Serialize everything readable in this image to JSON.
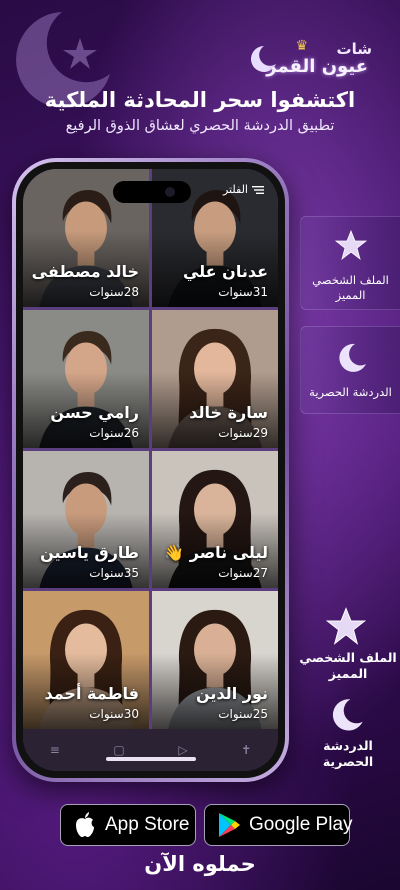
{
  "logo": {
    "line1": "شات",
    "line2": "عيون القمر"
  },
  "headline": "اكتشفوا سحر المحادثة الملكية",
  "subline": "تطبيق الدردشة الحصري لعشاق الذوق الرفيع",
  "phone": {
    "filter_label": "الفلتر",
    "profiles": [
      {
        "name": "خالد مصطفى",
        "age": "28سنوات",
        "skin": "#c69a7b",
        "hair": "#2a1d17",
        "bg": "#6a6460",
        "shirt": "#3b3f48",
        "gender": "m"
      },
      {
        "name": "عدنان علي",
        "age": "31سنوات",
        "skin": "#c89d7f",
        "hair": "#1e1512",
        "bg": "#2a2b30",
        "shirt": "#111316",
        "gender": "m"
      },
      {
        "name": "رامي حسن",
        "age": "26سنوات",
        "skin": "#d4a689",
        "hair": "#3a2a1e",
        "bg": "#8a8a86",
        "shirt": "#1e232a",
        "gender": "m"
      },
      {
        "name": "سارة خالد",
        "age": "29سنوات",
        "skin": "#e2b79c",
        "hair": "#3b2418",
        "bg": "#b09c8e",
        "shirt": "#6d5d55",
        "gender": "f"
      },
      {
        "name": "طارق ياسين",
        "age": "35سنوات",
        "skin": "#c99b7d",
        "hair": "#2b201b",
        "bg": "#b7b4b0",
        "shirt": "#1c2436",
        "gender": "m"
      },
      {
        "name": "ليلى ناصر 👋",
        "age": "27سنوات",
        "skin": "#d9b49a",
        "hair": "#241612",
        "bg": "#c9c3bc",
        "shirt": "#151515",
        "gender": "f"
      },
      {
        "name": "فاطمة أحمد",
        "age": "30سنوات",
        "skin": "#e4bb9d",
        "hair": "#3a2113",
        "bg": "#c79a6a",
        "shirt": "#c7a58a",
        "gender": "f"
      },
      {
        "name": "نور الدين",
        "age": "25سنوات",
        "skin": "#d9b095",
        "hair": "#2a1a12",
        "bg": "#d8d4ce",
        "shirt": "#9a9ea4",
        "gender": "f"
      }
    ],
    "nav_icons": [
      "menu-icon",
      "square-icon",
      "play-icon",
      "accessibility-icon"
    ]
  },
  "features": [
    {
      "label_1": "الملف الشخصي",
      "label_2": "المميز",
      "icon": "star-icon"
    },
    {
      "label_1": "الدردشة الحصرية",
      "label_2": "",
      "icon": "moon-icon"
    },
    {
      "label_1": "الملف الشخصي",
      "label_2": "المميز",
      "icon": "star-icon"
    },
    {
      "label_1": "الدردشة",
      "label_2": "الحصرية",
      "icon": "moon-icon"
    }
  ],
  "stores": {
    "apple": "App Store",
    "google": "Google Play"
  },
  "cta": "حملوه الآن",
  "colors": {
    "accent": "#7a3aa8",
    "background": "#2a0b45"
  }
}
